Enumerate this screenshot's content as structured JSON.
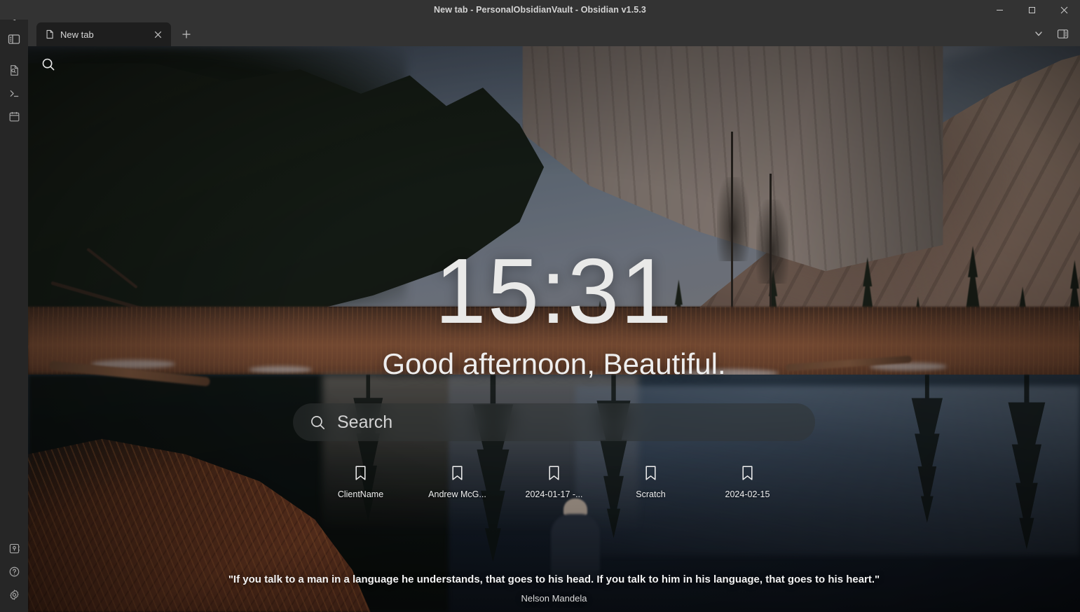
{
  "window": {
    "title": "New tab - PersonalObsidianVault - Obsidian v1.5.3",
    "controls": {
      "minimize": "minimize-button",
      "maximize": "maximize-button",
      "close": "close-button"
    }
  },
  "ribbon": {
    "logo": "obsidian-logo",
    "toggle_label": "Toggle left sidebar",
    "top_items": [
      {
        "name": "quick-switcher-icon",
        "label": "Quick switcher"
      },
      {
        "name": "terminal-icon",
        "label": "Terminal"
      },
      {
        "name": "calendar-icon",
        "label": "Calendar"
      }
    ],
    "bottom_items": [
      {
        "name": "vault-switcher-icon",
        "label": "Open another vault"
      },
      {
        "name": "help-icon",
        "label": "Help"
      },
      {
        "name": "settings-icon",
        "label": "Settings"
      }
    ]
  },
  "tabbar": {
    "tabs": [
      {
        "title": "New tab",
        "icon": "file-icon",
        "active": true,
        "close_label": "Close tab"
      }
    ],
    "new_tab_label": "New tab",
    "right_buttons": [
      {
        "name": "tab-list-chevron-down-icon",
        "label": "List all tabs"
      },
      {
        "name": "right-sidebar-toggle-icon",
        "label": "Toggle right sidebar"
      }
    ]
  },
  "newtab": {
    "search_icon_label": "Search",
    "clock": "15:31",
    "greeting": "Good afternoon, Beautiful.",
    "search": {
      "placeholder": "Search",
      "value": ""
    },
    "bookmarks": [
      {
        "label": "ClientName",
        "icon": "bookmark-icon"
      },
      {
        "label": "Andrew McG...",
        "icon": "bookmark-icon"
      },
      {
        "label": "2024-01-17 -...",
        "icon": "bookmark-icon"
      },
      {
        "label": "Scratch",
        "icon": "bookmark-icon"
      },
      {
        "label": "2024-02-15",
        "icon": "bookmark-icon"
      }
    ],
    "quote": {
      "text": "\"If you talk to a man in a language he understands, that goes to his head. If you talk to him in his language, that goes to his heart.\"",
      "author": "Nelson Mandela"
    }
  },
  "colors": {
    "titlebar_bg": "#333333",
    "tabbar_bg": "#333333",
    "active_tab_bg": "#1e1e1e",
    "ribbon_bg": "#262626",
    "text_primary": "#d4d4d4",
    "overlay_text": "#eeeeee",
    "close_hover": "#c42b1c"
  }
}
